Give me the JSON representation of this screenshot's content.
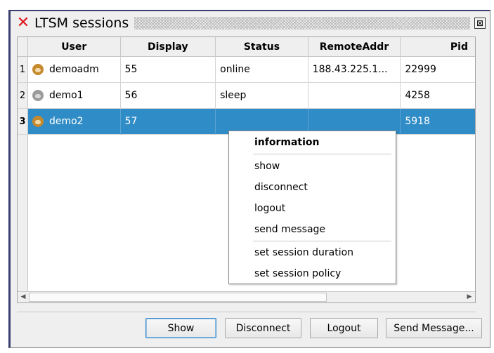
{
  "window": {
    "title": "LTSM sessions",
    "close_glyph": "⊠",
    "app_icon": "red-x-icon"
  },
  "table": {
    "columns": [
      "User",
      "Display",
      "Status",
      "RemoteAddr",
      "Pid"
    ],
    "rows": [
      {
        "num": "1",
        "user": "demoadm",
        "display": "55",
        "status": "online",
        "remote": "188.43.225.1...",
        "pid": "22999",
        "icon": "monkey-online-icon"
      },
      {
        "num": "2",
        "user": "demo1",
        "display": "56",
        "status": "sleep",
        "remote": "",
        "pid": "4258",
        "icon": "monkey-sleep-icon"
      },
      {
        "num": "3",
        "user": "demo2",
        "display": "57",
        "status": "",
        "remote": "",
        "pid": "5918",
        "icon": "monkey-online-icon",
        "selected": true
      }
    ],
    "scroll_left": "◀",
    "scroll_right": "▶"
  },
  "context_menu": {
    "header": "information",
    "items": [
      "show",
      "disconnect",
      "logout",
      "send message"
    ],
    "items2": [
      "set session duration",
      "set session policy"
    ]
  },
  "buttons": {
    "show": "Show",
    "disconnect": "Disconnect",
    "logout": "Logout",
    "send_message": "Send Message..."
  },
  "colors": {
    "selection": "#308cc6",
    "title_x": "#e0141e"
  }
}
